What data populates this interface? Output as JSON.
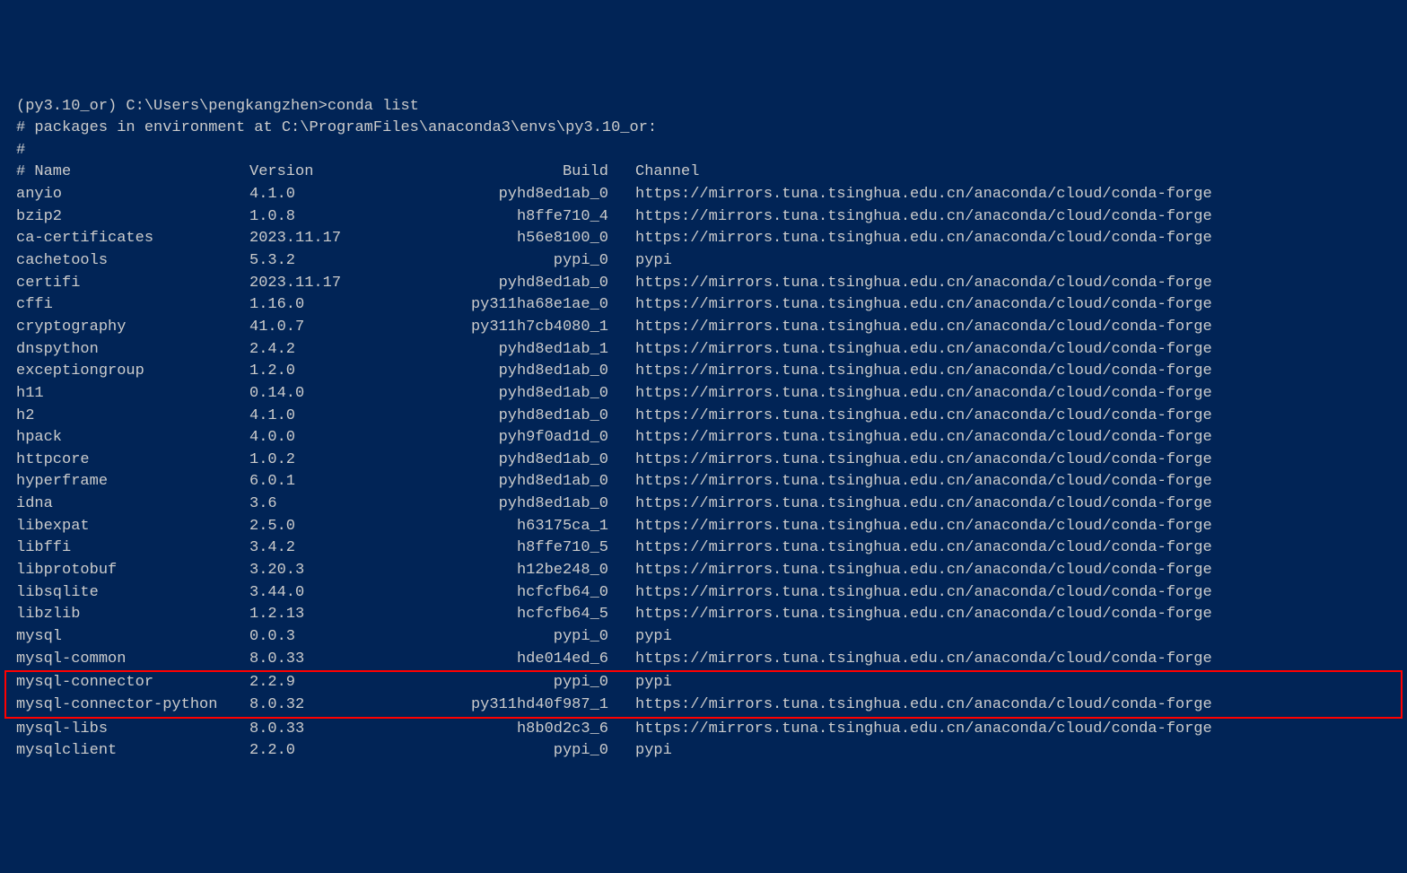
{
  "prompt": {
    "env": "(py3.10_or)",
    "path": "C:\\Users\\pengkangzhen>",
    "command": "conda list"
  },
  "env_comment": "# packages in environment at C:\\ProgramFiles\\anaconda3\\envs\\py3.10_or:",
  "hash_line": "#",
  "headers": {
    "name": "# Name",
    "version": "Version",
    "build": "Build",
    "channel": "Channel"
  },
  "channel_conda_forge": "https://mirrors.tuna.tsinghua.edu.cn/anaconda/cloud/conda-forge",
  "channel_pypi": "pypi",
  "packages": [
    {
      "name": "anyio",
      "version": "4.1.0",
      "build": "pyhd8ed1ab_0",
      "channel": "https://mirrors.tuna.tsinghua.edu.cn/anaconda/cloud/conda-forge",
      "highlight": false
    },
    {
      "name": "bzip2",
      "version": "1.0.8",
      "build": "h8ffe710_4",
      "channel": "https://mirrors.tuna.tsinghua.edu.cn/anaconda/cloud/conda-forge",
      "highlight": false
    },
    {
      "name": "ca-certificates",
      "version": "2023.11.17",
      "build": "h56e8100_0",
      "channel": "https://mirrors.tuna.tsinghua.edu.cn/anaconda/cloud/conda-forge",
      "highlight": false
    },
    {
      "name": "cachetools",
      "version": "5.3.2",
      "build": "pypi_0",
      "channel": "pypi",
      "highlight": false
    },
    {
      "name": "certifi",
      "version": "2023.11.17",
      "build": "pyhd8ed1ab_0",
      "channel": "https://mirrors.tuna.tsinghua.edu.cn/anaconda/cloud/conda-forge",
      "highlight": false
    },
    {
      "name": "cffi",
      "version": "1.16.0",
      "build": "py311ha68e1ae_0",
      "channel": "https://mirrors.tuna.tsinghua.edu.cn/anaconda/cloud/conda-forge",
      "highlight": false
    },
    {
      "name": "cryptography",
      "version": "41.0.7",
      "build": "py311h7cb4080_1",
      "channel": "https://mirrors.tuna.tsinghua.edu.cn/anaconda/cloud/conda-forge",
      "highlight": false
    },
    {
      "name": "dnspython",
      "version": "2.4.2",
      "build": "pyhd8ed1ab_1",
      "channel": "https://mirrors.tuna.tsinghua.edu.cn/anaconda/cloud/conda-forge",
      "highlight": false
    },
    {
      "name": "exceptiongroup",
      "version": "1.2.0",
      "build": "pyhd8ed1ab_0",
      "channel": "https://mirrors.tuna.tsinghua.edu.cn/anaconda/cloud/conda-forge",
      "highlight": false
    },
    {
      "name": "h11",
      "version": "0.14.0",
      "build": "pyhd8ed1ab_0",
      "channel": "https://mirrors.tuna.tsinghua.edu.cn/anaconda/cloud/conda-forge",
      "highlight": false
    },
    {
      "name": "h2",
      "version": "4.1.0",
      "build": "pyhd8ed1ab_0",
      "channel": "https://mirrors.tuna.tsinghua.edu.cn/anaconda/cloud/conda-forge",
      "highlight": false
    },
    {
      "name": "hpack",
      "version": "4.0.0",
      "build": "pyh9f0ad1d_0",
      "channel": "https://mirrors.tuna.tsinghua.edu.cn/anaconda/cloud/conda-forge",
      "highlight": false
    },
    {
      "name": "httpcore",
      "version": "1.0.2",
      "build": "pyhd8ed1ab_0",
      "channel": "https://mirrors.tuna.tsinghua.edu.cn/anaconda/cloud/conda-forge",
      "highlight": false
    },
    {
      "name": "hyperframe",
      "version": "6.0.1",
      "build": "pyhd8ed1ab_0",
      "channel": "https://mirrors.tuna.tsinghua.edu.cn/anaconda/cloud/conda-forge",
      "highlight": false
    },
    {
      "name": "idna",
      "version": "3.6",
      "build": "pyhd8ed1ab_0",
      "channel": "https://mirrors.tuna.tsinghua.edu.cn/anaconda/cloud/conda-forge",
      "highlight": false
    },
    {
      "name": "libexpat",
      "version": "2.5.0",
      "build": "h63175ca_1",
      "channel": "https://mirrors.tuna.tsinghua.edu.cn/anaconda/cloud/conda-forge",
      "highlight": false
    },
    {
      "name": "libffi",
      "version": "3.4.2",
      "build": "h8ffe710_5",
      "channel": "https://mirrors.tuna.tsinghua.edu.cn/anaconda/cloud/conda-forge",
      "highlight": false
    },
    {
      "name": "libprotobuf",
      "version": "3.20.3",
      "build": "h12be248_0",
      "channel": "https://mirrors.tuna.tsinghua.edu.cn/anaconda/cloud/conda-forge",
      "highlight": false
    },
    {
      "name": "libsqlite",
      "version": "3.44.0",
      "build": "hcfcfb64_0",
      "channel": "https://mirrors.tuna.tsinghua.edu.cn/anaconda/cloud/conda-forge",
      "highlight": false
    },
    {
      "name": "libzlib",
      "version": "1.2.13",
      "build": "hcfcfb64_5",
      "channel": "https://mirrors.tuna.tsinghua.edu.cn/anaconda/cloud/conda-forge",
      "highlight": false
    },
    {
      "name": "mysql",
      "version": "0.0.3",
      "build": "pypi_0",
      "channel": "pypi",
      "highlight": false
    },
    {
      "name": "mysql-common",
      "version": "8.0.33",
      "build": "hde014ed_6",
      "channel": "https://mirrors.tuna.tsinghua.edu.cn/anaconda/cloud/conda-forge",
      "highlight": false
    },
    {
      "name": "mysql-connector",
      "version": "2.2.9",
      "build": "pypi_0",
      "channel": "pypi",
      "highlight": true
    },
    {
      "name": "mysql-connector-python",
      "version": "8.0.32",
      "build": "py311hd40f987_1",
      "channel": "https://mirrors.tuna.tsinghua.edu.cn/anaconda/cloud/conda-forge",
      "highlight": true
    },
    {
      "name": "mysql-libs",
      "version": "8.0.33",
      "build": "h8b0d2c3_6",
      "channel": "https://mirrors.tuna.tsinghua.edu.cn/anaconda/cloud/conda-forge",
      "highlight": false
    },
    {
      "name": "mysqlclient",
      "version": "2.2.0",
      "build": "pypi_0",
      "channel": "pypi",
      "highlight": false
    }
  ]
}
